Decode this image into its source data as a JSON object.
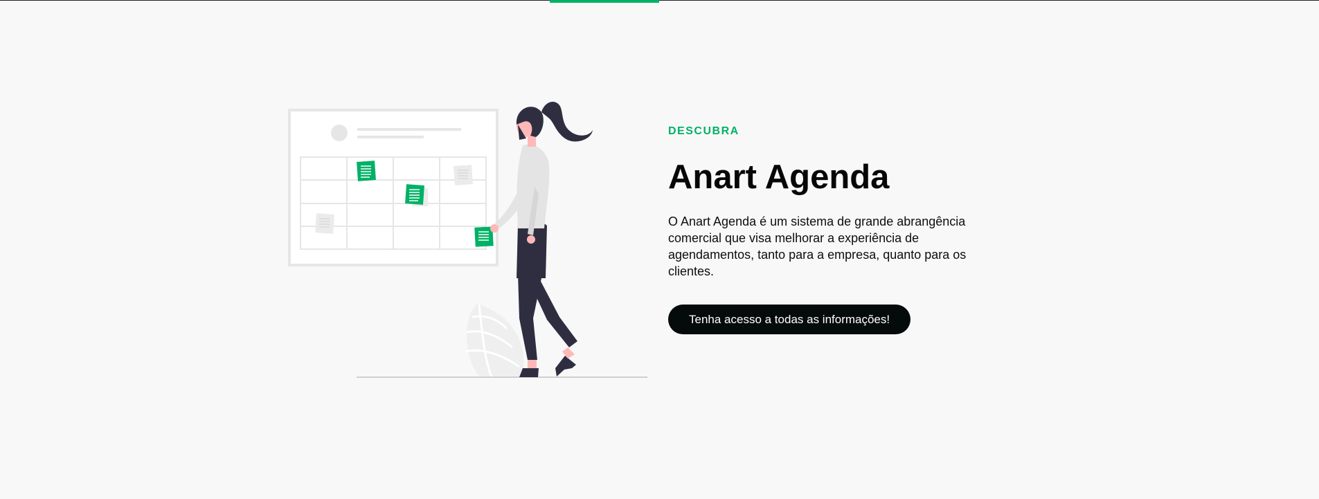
{
  "hero": {
    "eyebrow": "DESCUBRA",
    "title": "Anart Agenda",
    "description": "O Anart Agenda é um sistema de grande abrangência comercial que visa melhorar a experiência de agendamentos, tanto para a empresa, quanto para os clientes.",
    "cta_label": "Tenha acesso a todas as informações!"
  },
  "illustration": {
    "name": "woman-with-calendar-board-illustration"
  },
  "colors": {
    "accent": "#00b166",
    "background": "#f8f8f8",
    "button": "#050b0b",
    "text": "#070707",
    "figure_dark": "#2f2e41",
    "board_gray": "#e6e6e6",
    "skin": "#ffb8b8"
  }
}
